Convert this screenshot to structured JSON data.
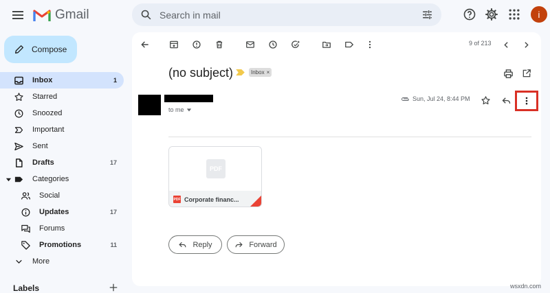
{
  "header": {
    "app_name": "Gmail",
    "search_placeholder": "Search in mail",
    "avatar_letter": "i"
  },
  "sidebar": {
    "compose_label": "Compose",
    "items": [
      {
        "label": "Inbox",
        "count": "1"
      },
      {
        "label": "Starred",
        "count": ""
      },
      {
        "label": "Snoozed",
        "count": ""
      },
      {
        "label": "Important",
        "count": ""
      },
      {
        "label": "Sent",
        "count": ""
      },
      {
        "label": "Drafts",
        "count": "17"
      },
      {
        "label": "Categories",
        "count": ""
      },
      {
        "label": "Social",
        "count": ""
      },
      {
        "label": "Updates",
        "count": "17"
      },
      {
        "label": "Forums",
        "count": ""
      },
      {
        "label": "Promotions",
        "count": "11"
      },
      {
        "label": "More",
        "count": ""
      }
    ],
    "labels_heading": "Labels"
  },
  "toolbar": {
    "pager": "9 of 213"
  },
  "message": {
    "subject": "(no subject)",
    "label_chip": "Inbox",
    "chip_close": "×",
    "to_me": "to me",
    "date": "Sun, Jul 24, 8:44 PM",
    "attachment": {
      "preview_text": "PDF",
      "badge": "PDF",
      "name": "Corporate financ..."
    },
    "reply_label": "Reply",
    "forward_label": "Forward"
  },
  "watermark": "wsxdn.com",
  "colors": {
    "compose_bg": "#c2e7ff",
    "active_nav_bg": "#d3e3fd",
    "highlight_box": "#d93025",
    "avatar_bg": "#c2410c",
    "pdf_red": "#ea4335"
  }
}
